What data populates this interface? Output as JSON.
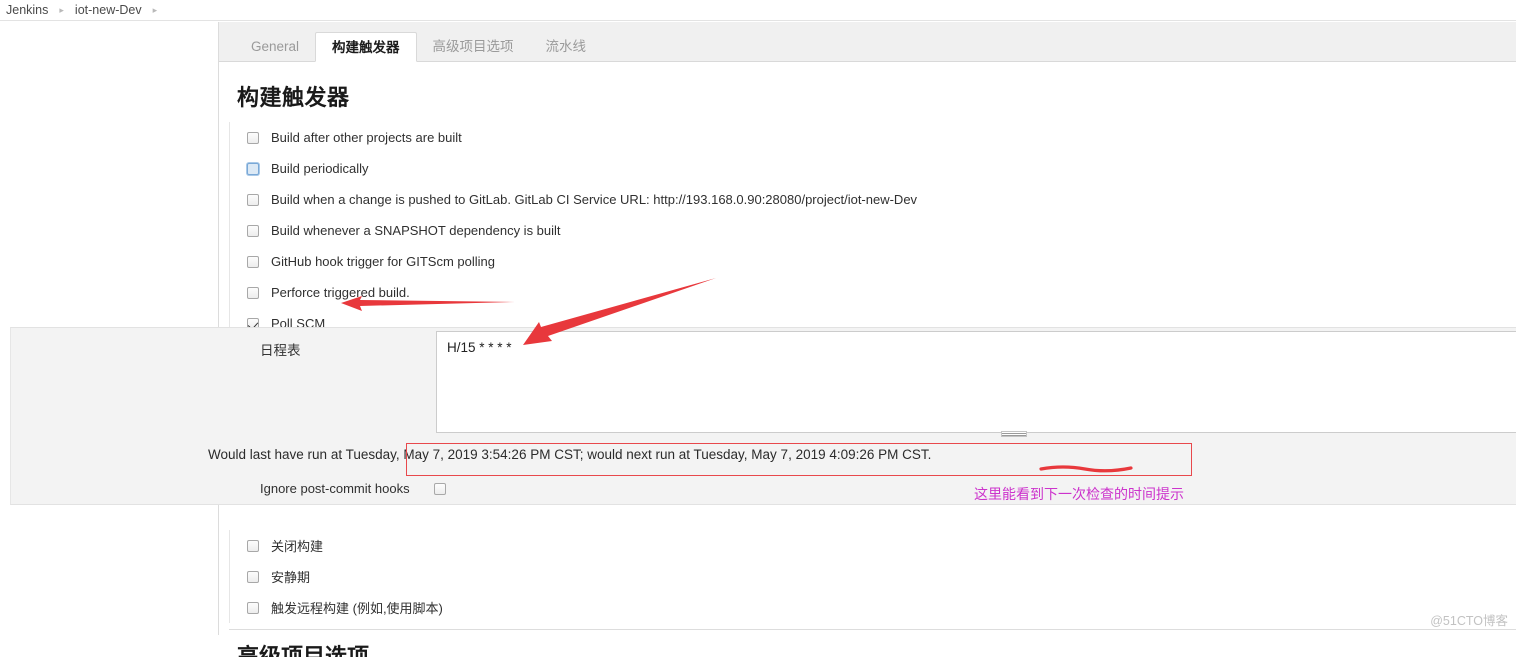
{
  "breadcrumb": {
    "items": [
      "Jenkins",
      "iot-new-Dev"
    ],
    "separator": "▸",
    "trailing_separator": "▸"
  },
  "tabs": [
    {
      "label": "General",
      "active": false
    },
    {
      "label": "构建触发器",
      "active": true
    },
    {
      "label": "高级项目选项",
      "active": false
    },
    {
      "label": "流水线",
      "active": false
    }
  ],
  "section": {
    "heading": "构建触发器",
    "next_heading": "高级项目选项"
  },
  "triggers": [
    {
      "label": "Build after other projects are built",
      "checked": false,
      "focused": false
    },
    {
      "label": "Build periodically",
      "checked": false,
      "focused": true
    },
    {
      "label": "Build when a change is pushed to GitLab. GitLab CI Service URL: http://193.168.0.90:28080/project/iot-new-Dev",
      "checked": false,
      "focused": false
    },
    {
      "label": "Build whenever a SNAPSHOT dependency is built",
      "checked": false,
      "focused": false
    },
    {
      "label": "GitHub hook trigger for GITScm polling",
      "checked": false,
      "focused": false
    },
    {
      "label": "Perforce triggered build.",
      "checked": false,
      "focused": false
    },
    {
      "label": "Poll SCM",
      "checked": true,
      "focused": false
    }
  ],
  "poll_scm": {
    "schedule_label": "日程表",
    "schedule_value": "H/15 * * * *",
    "schedule_placeholder": "",
    "validation_message": "Would last have run at Tuesday, May 7, 2019 3:54:26 PM CST; would next run at Tuesday, May 7, 2019 4:09:26 PM CST.",
    "ignore_hooks_label": "Ignore post-commit hooks",
    "ignore_hooks_checked": false
  },
  "lower_options": [
    {
      "label": "关闭构建",
      "checked": false
    },
    {
      "label": "安静期",
      "checked": false
    },
    {
      "label": "触发远程构建 (例如,使用脚本)",
      "checked": false
    }
  ],
  "annotations": {
    "note_text": "这里能看到下一次检查的时间提示",
    "note_color": "#cc33cc",
    "arrow_color": "#e8383c",
    "box_color": "#e8484c"
  },
  "watermark": "@51CTO博客"
}
